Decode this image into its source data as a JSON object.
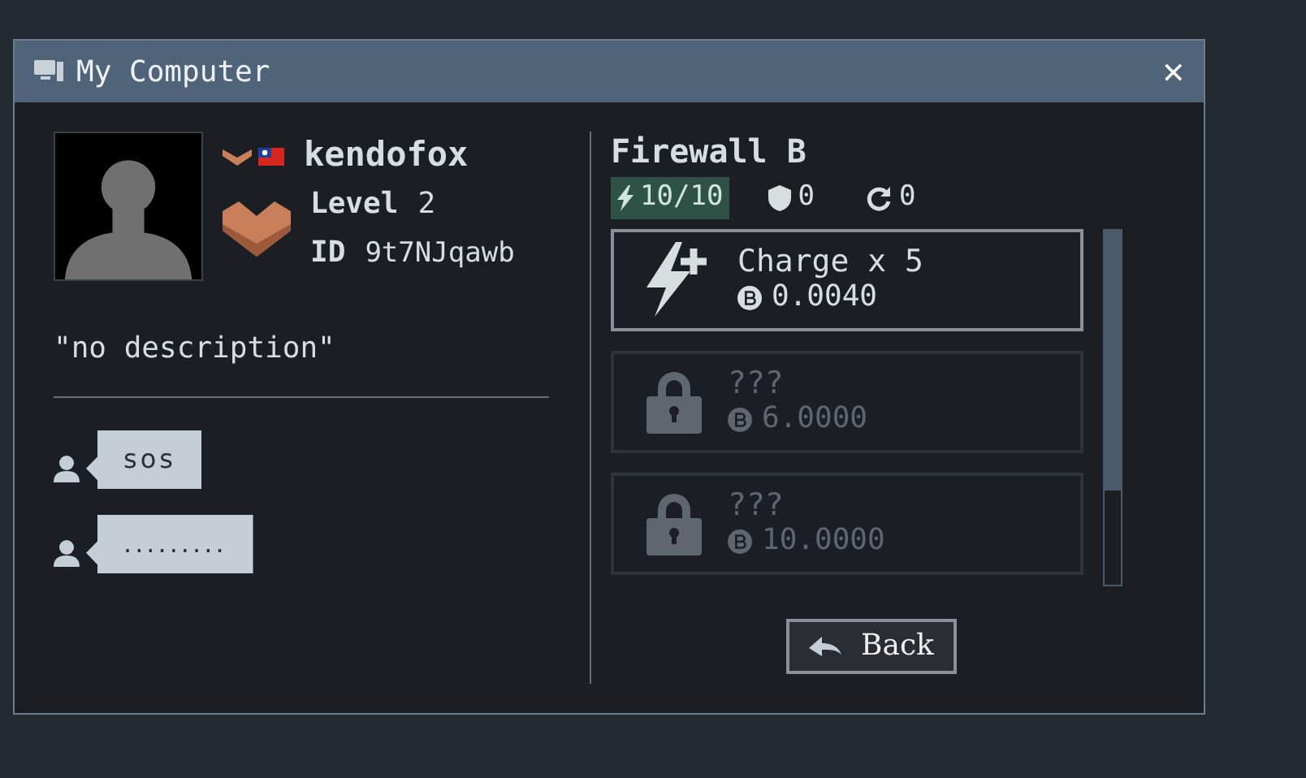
{
  "window": {
    "title": "My Computer",
    "close": "✕"
  },
  "profile": {
    "username": "kendofox",
    "level_label": "Level",
    "level": "2",
    "id_label": "ID",
    "id": "9t7NJqawb",
    "description": "\"no description\""
  },
  "messages": [
    {
      "text": "sos"
    },
    {
      "text": "........."
    }
  ],
  "firewall": {
    "title": "Firewall B",
    "charge": "10/10",
    "shield": "0",
    "regen": "0"
  },
  "upgrades": [
    {
      "name": "Charge x 5",
      "price": "0.0040",
      "locked": false
    },
    {
      "name": "???",
      "price": "6.0000",
      "locked": true
    },
    {
      "name": "???",
      "price": "10.0000",
      "locked": true
    }
  ],
  "back_button": "Back"
}
